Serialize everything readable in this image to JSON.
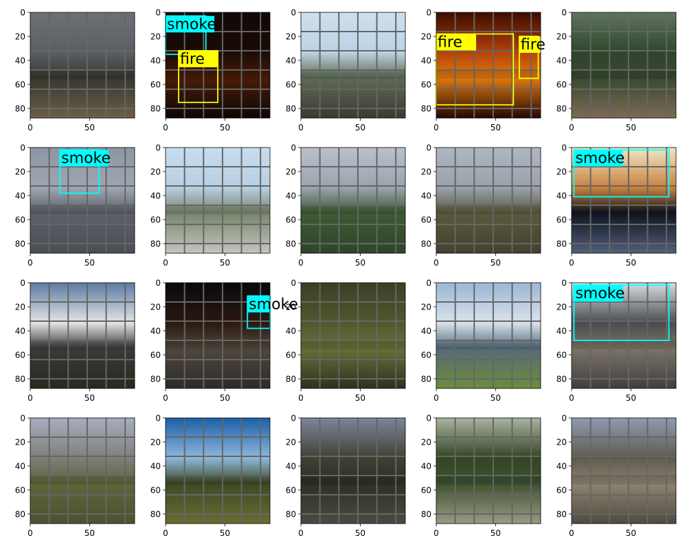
{
  "figure": {
    "grid": {
      "rows": 4,
      "cols": 5
    },
    "x_ticks": [
      "0",
      "50"
    ],
    "y_ticks": [
      "0",
      "20",
      "40",
      "60",
      "80"
    ],
    "data_extent": [
      0,
      88
    ],
    "gridlines_every": 16,
    "colors": {
      "fire_box": "#ffff00",
      "smoke_box": "#00ffff",
      "gridline": "#666666",
      "label_text": "#000000"
    },
    "panels": [
      {
        "scene": "overcast-sky-hillside",
        "colors": [
          "#6d7176",
          "#5b5f64",
          "#35382f",
          "#6e5e48"
        ],
        "detections": []
      },
      {
        "scene": "night-fire",
        "colors": [
          "#120806",
          "#1a0b05",
          "#4a1d08",
          "#0c0604"
        ],
        "detections": [
          {
            "label": "smoke",
            "box": [
              0,
              3,
              34,
              35
            ]
          },
          {
            "label": "fire",
            "box": [
              11,
              32,
              44,
              75
            ]
          }
        ]
      },
      {
        "scene": "hilltop-town-view",
        "colors": [
          "#cfe0ee",
          "#bcd2e4",
          "#5d6b53",
          "#3b3a34"
        ],
        "detections": []
      },
      {
        "scene": "blaze-closeup",
        "colors": [
          "#3b0c02",
          "#b64208",
          "#e17a0f",
          "#230804"
        ],
        "detections": [
          {
            "label": "fire",
            "box": [
              0,
              18,
              65,
              77
            ]
          },
          {
            "label": "fire",
            "box": [
              70,
              20,
              86,
              55
            ]
          }
        ]
      },
      {
        "scene": "forest-overlook",
        "colors": [
          "#607560",
          "#2f452c",
          "#38492f",
          "#7d6a54"
        ],
        "detections": []
      },
      {
        "scene": "smoky-ridge",
        "colors": [
          "#8d96a3",
          "#9ea6b1",
          "#5c6068",
          "#4a4e55"
        ],
        "detections": [
          {
            "label": "smoke",
            "box": [
              25,
              2,
              58,
              38
            ]
          }
        ]
      },
      {
        "scene": "roadside-sunny",
        "colors": [
          "#c8ddee",
          "#b7cfe3",
          "#78856b",
          "#c5c5c0"
        ],
        "detections": []
      },
      {
        "scene": "valley-road",
        "colors": [
          "#b9c0cb",
          "#9aa4ae",
          "#3f5a32",
          "#2f442a"
        ],
        "detections": []
      },
      {
        "scene": "grassy-slope-haze",
        "colors": [
          "#aeb6c1",
          "#9aa2ac",
          "#5a5a3c",
          "#463f2f"
        ],
        "detections": []
      },
      {
        "scene": "orange-smoke-plume",
        "colors": [
          "#f0e6c8",
          "#c9823e",
          "#0f1420",
          "#52607a"
        ],
        "detections": [
          {
            "label": "smoke",
            "box": [
              2,
              2,
              82,
              41
            ]
          }
        ]
      },
      {
        "scene": "cumulus-evening",
        "colors": [
          "#5c7ba4",
          "#e4e5e3",
          "#3a3a38",
          "#27291f"
        ],
        "detections": []
      },
      {
        "scene": "night-street-vehicles",
        "colors": [
          "#08090d",
          "#2a1810",
          "#51473c",
          "#2b2b2b"
        ],
        "detections": [
          {
            "label": "smoke",
            "box": [
              69,
              11,
              88,
              38
            ]
          }
        ]
      },
      {
        "scene": "green-hillside",
        "colors": [
          "#3c3f24",
          "#52572f",
          "#667038",
          "#2d321e"
        ],
        "detections": []
      },
      {
        "scene": "mountain-lake",
        "colors": [
          "#9cb6d4",
          "#d9e2ea",
          "#556b7a",
          "#6e8b3a"
        ],
        "detections": []
      },
      {
        "scene": "street-smoke-column",
        "colors": [
          "#d9dde2",
          "#4a4c4e",
          "#7c7366",
          "#3f3f40"
        ],
        "detections": [
          {
            "label": "smoke",
            "box": [
              2,
              2,
              82,
              48
            ]
          }
        ]
      },
      {
        "scene": "dusk-hills",
        "colors": [
          "#a8aec0",
          "#7f7e7a",
          "#5e6638",
          "#4b5232"
        ],
        "detections": []
      },
      {
        "scene": "blue-sky-field",
        "colors": [
          "#1d5ea6",
          "#8db7dc",
          "#3e4a26",
          "#6b6a32"
        ],
        "detections": []
      },
      {
        "scene": "rocky-ridge",
        "colors": [
          "#7d879a",
          "#3f4033",
          "#2e3024",
          "#4c4a40"
        ],
        "detections": []
      },
      {
        "scene": "forest-road",
        "colors": [
          "#a9b4a0",
          "#334525",
          "#3d5130",
          "#9a9b86"
        ],
        "detections": []
      },
      {
        "scene": "eroded-slope",
        "colors": [
          "#909bb2",
          "#5d5a4e",
          "#8d8371",
          "#4f4b42"
        ],
        "detections": []
      }
    ]
  }
}
